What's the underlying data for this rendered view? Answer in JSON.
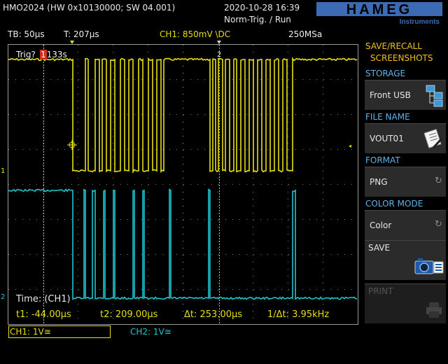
{
  "header": {
    "model": "HMO2024 (HW 0x10130000; SW 04.001)",
    "datetime": "2020-10-28 16:39",
    "trigger_mode": "Norm-Trig. / Run",
    "brand": "HAMEG",
    "brand_sub": "Instruments"
  },
  "settings": {
    "timebase": "TB: 50µs",
    "trigger_time": "T: 207µs",
    "ch1": "CH1: 850mV \\DC",
    "sample_rate": "250MSa"
  },
  "waveform": {
    "trig_label": "Trig?",
    "trig_value": "133s",
    "marker_1": "1",
    "marker_2": "2",
    "ch1_marker": "1",
    "ch2_marker": "2",
    "cursor_title": "Time: (CH1)",
    "t1": "t1: -44.00µs",
    "t2": "t2: 209.00µs",
    "dt": "Δt: 253.00µs",
    "freq": "1/Δt: 3.95kHz"
  },
  "footer": {
    "ch1": "CH1: 1V≅",
    "ch2": "CH2: 1V≅"
  },
  "menu": {
    "title_line1": "SAVE/RECALL",
    "title_line2": "SCREENSHOTS",
    "storage_title": "STORAGE",
    "storage_value": "Front USB",
    "filename_title": "FILE NAME",
    "filename_value": "VOUT01",
    "format_title": "FORMAT",
    "format_value": "PNG",
    "colormode_title": "COLOR MODE",
    "colormode_value": "Color",
    "save_label": "SAVE",
    "print_label": "PRINT"
  },
  "colors": {
    "ch1": "#e6de12",
    "ch2": "#1fc4cf",
    "menu_title": "#f0c020",
    "section_title": "#5fb4e6",
    "brand": "#3a6bb4"
  },
  "icons": {
    "storage": "usb-folders-icon",
    "filename": "notepad-pen-icon",
    "save": "camera-icon",
    "format": "rotate-icon",
    "colormode": "rotate-icon",
    "print": "printer-icon"
  }
}
